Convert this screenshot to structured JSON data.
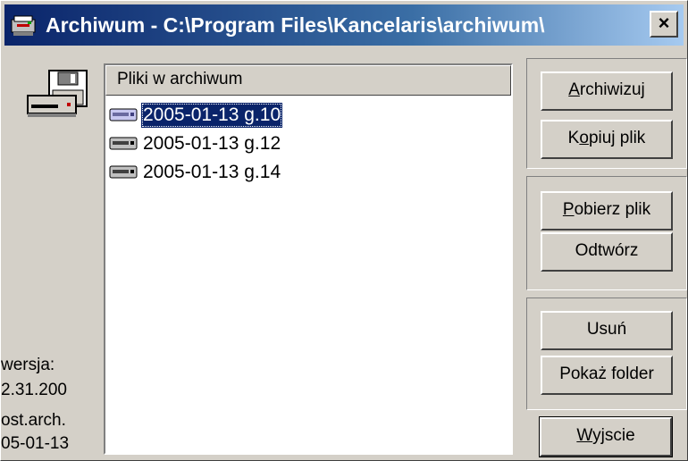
{
  "window": {
    "title": "Archiwum - C:\\Program Files\\Kancelaris\\archiwum\\",
    "close_label": "×"
  },
  "list": {
    "header": "Pliki w archiwum",
    "items": [
      {
        "label": "2005-01-13 g.10",
        "selected": true
      },
      {
        "label": "2005-01-13 g.12",
        "selected": false
      },
      {
        "label": "2005-01-13 g.14",
        "selected": false
      }
    ]
  },
  "info": {
    "version_label": "wersja:",
    "version_value": "2.31.200",
    "last_arch_label": "ost.arch.",
    "last_arch_value": "05-01-13"
  },
  "buttons": {
    "archiwizuj": {
      "pre": "",
      "u": "A",
      "post": "rchiwizuj"
    },
    "kopiuj": {
      "pre": "K",
      "u": "o",
      "post": "piuj plik"
    },
    "pobierz": {
      "pre": "",
      "u": "P",
      "post": "obierz plik"
    },
    "odtworz": {
      "label": "Odtwórz"
    },
    "usun": {
      "label": "Usuń"
    },
    "pokaz": {
      "label": "Pokaż folder"
    },
    "wyjscie": {
      "pre": "",
      "u": "W",
      "post": "yjscie"
    }
  },
  "colors": {
    "titlebar_start": "#0a246a",
    "titlebar_end": "#a6caf0",
    "selection": "#0a246a",
    "face": "#d4d0c8"
  }
}
